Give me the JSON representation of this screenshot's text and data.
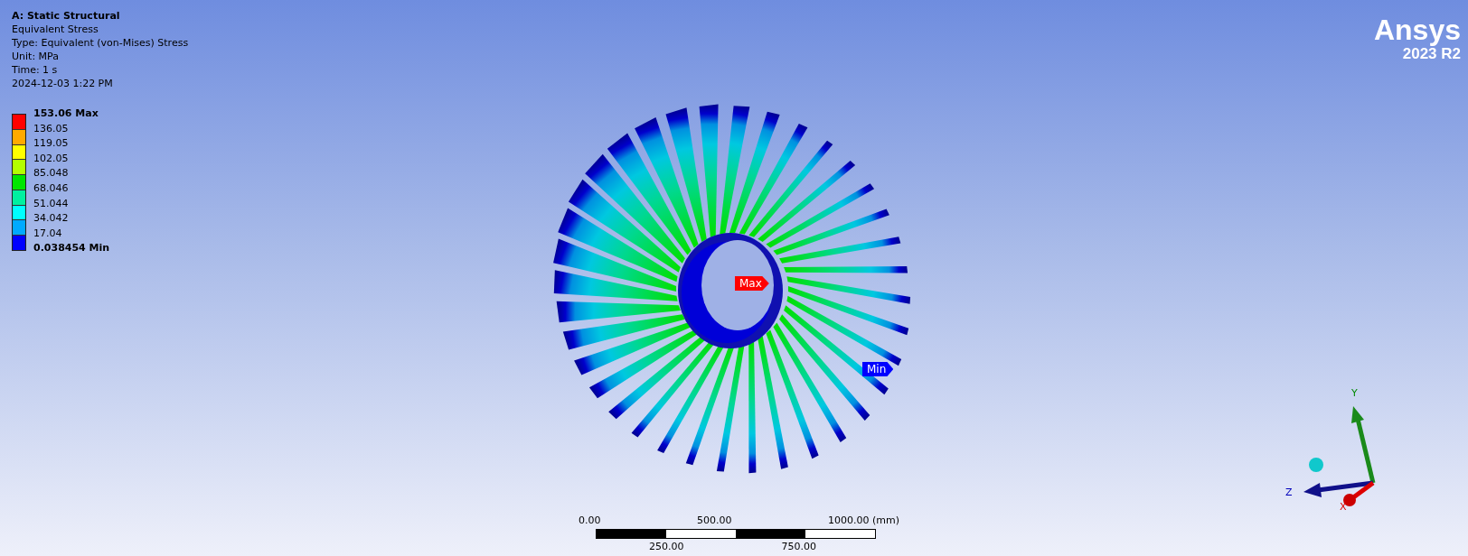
{
  "info": {
    "title": "A: Static Structural",
    "lines": [
      "Equivalent Stress",
      "Type: Equivalent (von-Mises) Stress",
      "Unit: MPa",
      "Time: 1 s",
      "2024-12-03 1:22 PM"
    ]
  },
  "legend": {
    "labels": [
      {
        "text": "153.06 Max",
        "kind": "max"
      },
      {
        "text": "136.05",
        "kind": "value"
      },
      {
        "text": "119.05",
        "kind": "value"
      },
      {
        "text": "102.05",
        "kind": "value"
      },
      {
        "text": "85.048",
        "kind": "value"
      },
      {
        "text": "68.046",
        "kind": "value"
      },
      {
        "text": "51.044",
        "kind": "value"
      },
      {
        "text": "34.042",
        "kind": "value"
      },
      {
        "text": "17.04",
        "kind": "value"
      },
      {
        "text": "0.038454 Min",
        "kind": "min"
      }
    ],
    "bands": [
      {
        "color": "#ff0000"
      },
      {
        "color": "#ffaa00"
      },
      {
        "color": "#ffff00"
      },
      {
        "color": "#b4ff00"
      },
      {
        "color": "#00e600"
      },
      {
        "color": "#00f0a0"
      },
      {
        "color": "#00ffff"
      },
      {
        "color": "#00aaff"
      },
      {
        "color": "#0000ff"
      }
    ]
  },
  "logo": {
    "name": "Ansys",
    "version": "2023 R2"
  },
  "probes": [
    {
      "label": "Max",
      "kind": "max"
    },
    {
      "label": "Min",
      "kind": "min"
    }
  ],
  "scale_bar": {
    "top_labels": [
      "0.00",
      "500.00",
      "1000.00 (mm)"
    ],
    "bottom_labels": [
      "250.00",
      "750.00"
    ]
  },
  "triad": {
    "axes": [
      "Y",
      "Z",
      "X"
    ]
  }
}
